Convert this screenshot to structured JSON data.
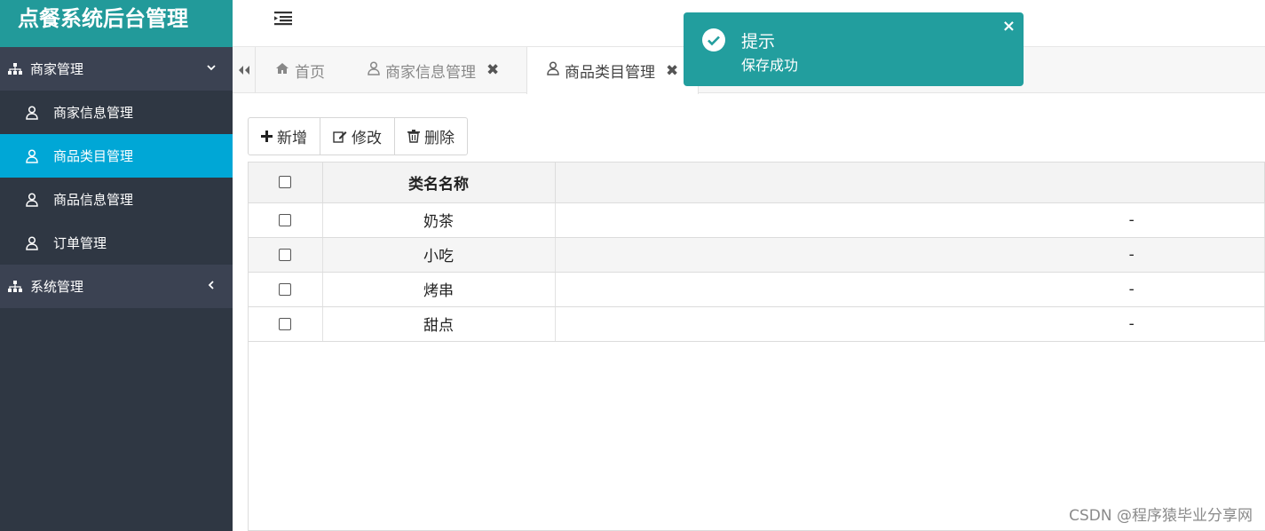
{
  "brand": {
    "title": "点餐系统后台管理"
  },
  "sidebar": {
    "groups": [
      {
        "label": "商家管理",
        "items": [
          {
            "label": "商家信息管理"
          },
          {
            "label": "商品类目管理",
            "active": true
          },
          {
            "label": "商品信息管理"
          },
          {
            "label": "订单管理"
          }
        ]
      },
      {
        "label": "系统管理"
      }
    ]
  },
  "tabs": [
    {
      "label": "首页"
    },
    {
      "label": "商家信息管理"
    },
    {
      "label": "商品类目管理",
      "active": true
    }
  ],
  "toolbar": {
    "add_label": "新增",
    "edit_label": "修改",
    "delete_label": "删除"
  },
  "table": {
    "columns": [
      "类名名称"
    ],
    "rows": [
      {
        "name": "奶茶",
        "extra": "-"
      },
      {
        "name": "小吃",
        "extra": "-"
      },
      {
        "name": "烤串",
        "extra": "-"
      },
      {
        "name": "甜点",
        "extra": "-"
      }
    ]
  },
  "toast": {
    "title": "提示",
    "message": "保存成功",
    "close": "×"
  },
  "watermark": "CSDN @程序猿毕业分享网",
  "colors": {
    "brand": "#229a9a",
    "sidebar": "#2f3743",
    "active": "#00a7d6",
    "toast": "#229e9e"
  }
}
